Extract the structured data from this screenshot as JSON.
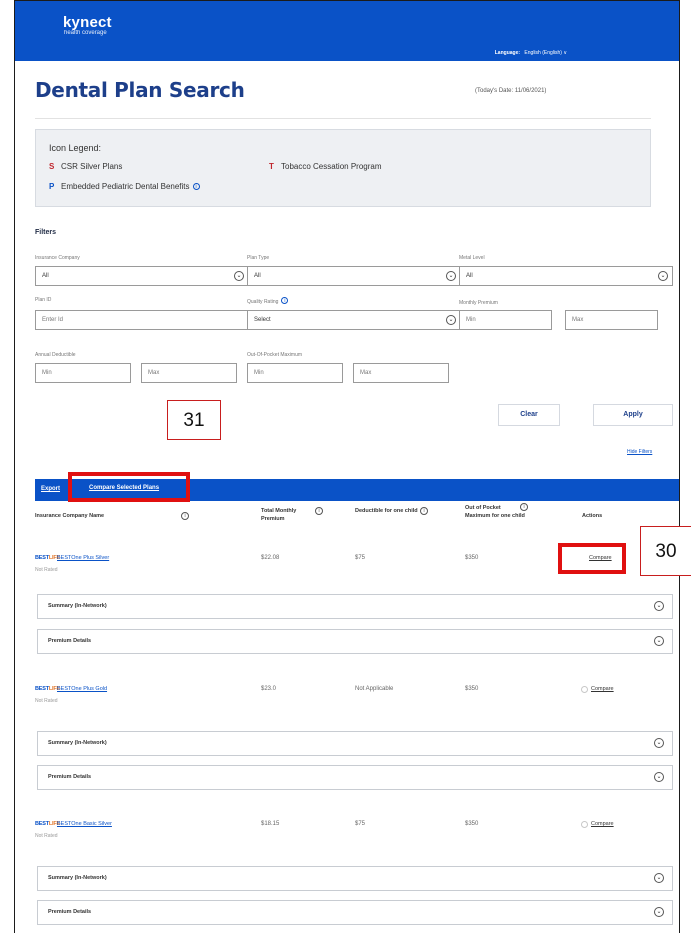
{
  "header": {
    "logo_name": "kynect",
    "logo_sub": "health coverage",
    "language_label": "Language:",
    "language_value": "English (English) ∨"
  },
  "page": {
    "title": "Dental Plan Search",
    "today": "(Today's Date: 11/06/2021)"
  },
  "legend": {
    "title": "Icon Legend:",
    "items": [
      {
        "glyph": "S",
        "label": "CSR Silver Plans"
      },
      {
        "glyph": "T",
        "label": "Tobacco Cessation Program"
      },
      {
        "glyph": "P",
        "label": "Embedded Pediatric Dental Benefits"
      }
    ],
    "info_glyph": "i"
  },
  "filters": {
    "title": "Filters",
    "insurance_company": {
      "label": "Insurance Company",
      "value": "All"
    },
    "plan_type": {
      "label": "Plan Type",
      "value": "All"
    },
    "metal_level": {
      "label": "Metal Level",
      "value": "All"
    },
    "plan_id": {
      "label": "Plan ID",
      "placeholder": "Enter Id"
    },
    "quality_rating": {
      "label": "Quality Rating",
      "value": "Select"
    },
    "monthly_premium": {
      "label": "Monthly Premium",
      "min": "Min",
      "max": "Max"
    },
    "annual_deductible": {
      "label": "Annual Deductible",
      "min": "Min",
      "max": "Max"
    },
    "oop_maximum": {
      "label": "Out-Of-Pocket Maximum",
      "min": "Min",
      "max": "Max"
    },
    "chevron_glyph": "⌄",
    "clear_label": "Clear",
    "apply_label": "Apply",
    "hide_label": "Hide Filters"
  },
  "table": {
    "export_label": "Export",
    "compare_selected_label": "Compare Selected Plans",
    "headers": {
      "company": "Insurance Company Name",
      "premium": "Total Monthly Premium",
      "deductible": "Deductible for one child",
      "oop": "Out of Pocket Maximum for one child",
      "actions": "Actions"
    },
    "brand_prefix": "BEST",
    "brand_suffix": "LIFE",
    "compare_label": "Compare",
    "summary_label": "Summary (In-Network)",
    "premium_details_label": "Premium Details",
    "rows": [
      {
        "plan": "BESTOne Plus Silver",
        "rating": "Not Rated",
        "premium": "$22.08",
        "deductible": "$75",
        "oop": "$350"
      },
      {
        "plan": "BESTOne Plus Gold",
        "rating": "Not Rated",
        "premium": "$23.0",
        "deductible": "Not Applicable",
        "oop": "$350"
      },
      {
        "plan": "BESTOne Basic Silver",
        "rating": "Not Rated",
        "premium": "$18.15",
        "deductible": "$75",
        "oop": "$350"
      }
    ]
  },
  "callouts": {
    "c31": "31",
    "c30": "30"
  },
  "colors": {
    "brand_blue": "#0a52c7",
    "title_navy": "#1d3f8a",
    "callout_red": "#e01010"
  }
}
